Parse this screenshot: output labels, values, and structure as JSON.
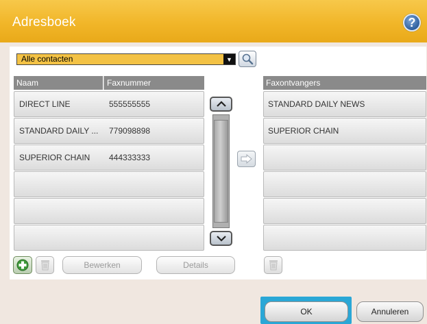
{
  "header": {
    "title": "Adresboek",
    "help_label": "?"
  },
  "filter": {
    "selected": "Alle contacten"
  },
  "contacts": {
    "columns": [
      "Naam",
      "Faxnummer"
    ],
    "rows": [
      {
        "name": "DIRECT LINE",
        "number": "555555555"
      },
      {
        "name": "STANDARD DAILY ...",
        "number": "779098898"
      },
      {
        "name": "SUPERIOR CHAIN",
        "number": "444333333"
      },
      {
        "name": "",
        "number": ""
      },
      {
        "name": "",
        "number": ""
      },
      {
        "name": "",
        "number": ""
      }
    ]
  },
  "recipients": {
    "header": "Faxontvangers",
    "rows": [
      "STANDARD DAILY NEWS",
      "SUPERIOR CHAIN",
      "",
      "",
      "",
      ""
    ]
  },
  "toolbar": {
    "edit_label": "Bewerken",
    "details_label": "Details"
  },
  "footer": {
    "ok_label": "OK",
    "cancel_label": "Annuleren"
  },
  "colors": {
    "title_bar": "#f1b629",
    "focus": "#2aa7d6",
    "header": "#8a8a8a"
  }
}
